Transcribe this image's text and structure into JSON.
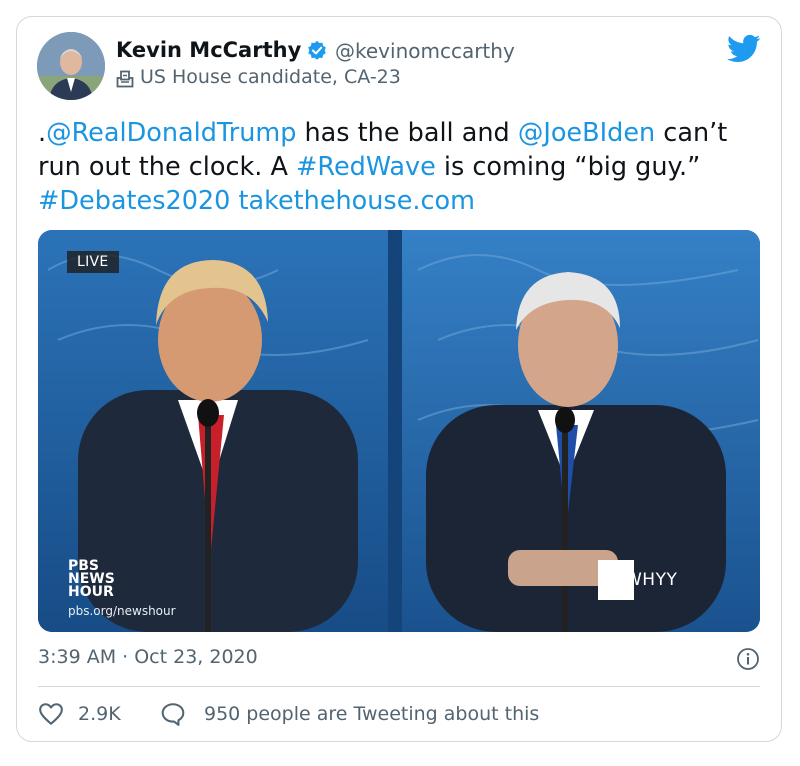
{
  "author": {
    "name": "Kevin McCarthy",
    "handle": "@kevinomccarthy",
    "label": "US House candidate, CA-23"
  },
  "tweet": {
    "text_parts": [
      {
        "text": ".",
        "link": false
      },
      {
        "text": "@RealDonaldTrump",
        "link": true
      },
      {
        "text": " has the ball and ",
        "link": false
      },
      {
        "text": "@JoeBIden",
        "link": true
      },
      {
        "text": " can’t run out the clock. A ",
        "link": false
      },
      {
        "text": "#RedWave",
        "link": true
      },
      {
        "text": " is coming “big guy.” ",
        "link": false
      },
      {
        "text": "#Debates2020",
        "link": true
      },
      {
        "text": " ",
        "link": false
      },
      {
        "text": "takethehouse.com",
        "link": true
      }
    ]
  },
  "media": {
    "live_badge": "LIVE",
    "pbs_logo": "PBS NEWS HOUR",
    "pbs_line1": "PBS",
    "pbs_line2": "NEWS",
    "pbs_line3": "HOUR",
    "pbs_url": "pbs.org/newshour",
    "station": "WHYY",
    "side_ticker": "PBS NEWSHOUR"
  },
  "timestamp": "3:39 AM · Oct 23, 2020",
  "engagement": {
    "likes": "2.9K",
    "discussion": "950 people are Tweeting about this"
  },
  "colors": {
    "link": "#1b95e0",
    "muted": "#536471",
    "verified": "#1d9bf0",
    "backdrop": "#1d5a97"
  },
  "icons": [
    "verified-badge-icon",
    "ballot-box-icon",
    "twitter-bird-icon",
    "info-icon",
    "heart-icon",
    "reply-bubble-icon"
  ]
}
